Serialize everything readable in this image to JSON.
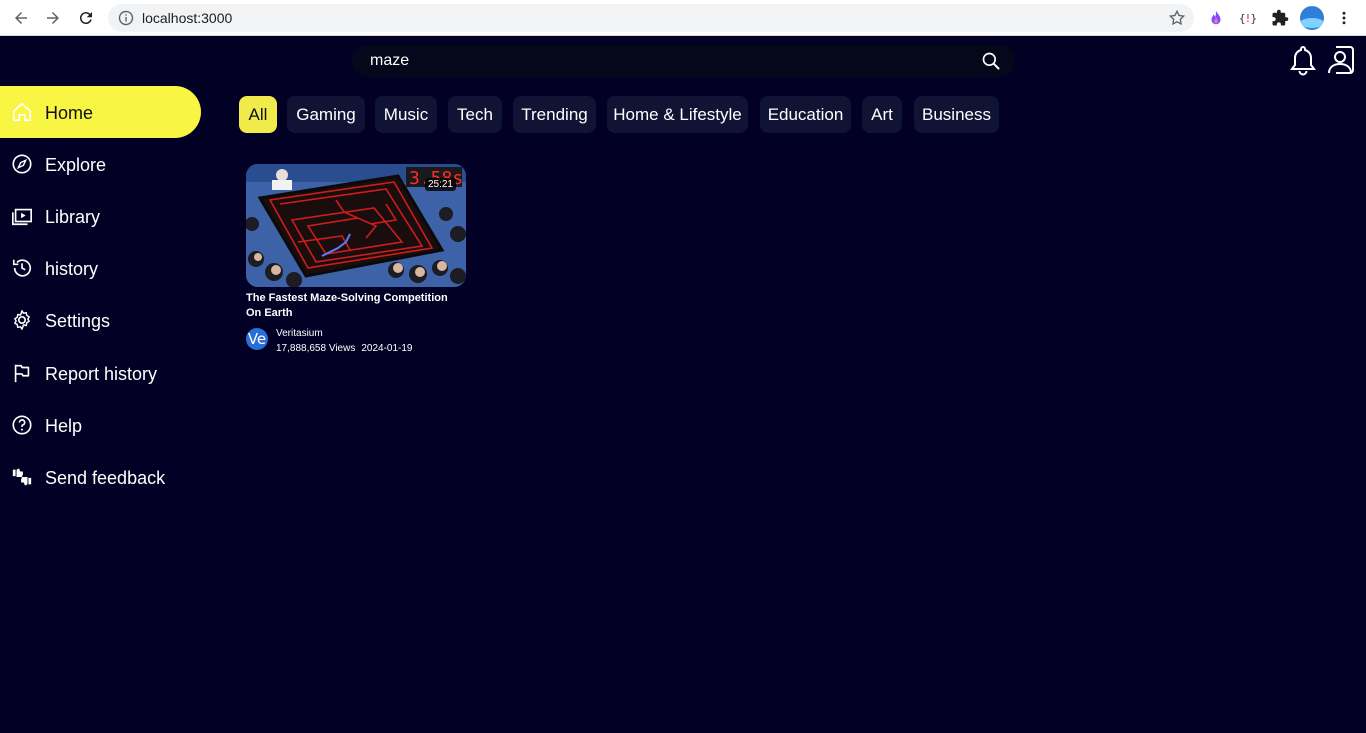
{
  "browser": {
    "url": "localhost:3000"
  },
  "search": {
    "value": "maze"
  },
  "sidebar": {
    "items": [
      {
        "label": "Home",
        "icon": "home-icon"
      },
      {
        "label": "Explore",
        "icon": "compass-icon"
      },
      {
        "label": "Library",
        "icon": "library-icon"
      },
      {
        "label": "history",
        "icon": "history-icon"
      },
      {
        "label": "Settings",
        "icon": "gear-icon"
      },
      {
        "label": "Report history",
        "icon": "flag-icon"
      },
      {
        "label": "Help",
        "icon": "help-icon"
      },
      {
        "label": "Send feedback",
        "icon": "feedback-icon"
      }
    ]
  },
  "chips": [
    "All",
    "Gaming",
    "Music",
    "Tech",
    "Trending",
    "Home & Lifestyle",
    "Education",
    "Art",
    "Business"
  ],
  "video": {
    "title": "The Fastest Maze-Solving Competition On Earth",
    "duration": "25:21",
    "channel": "Veritasium",
    "avatar_text": "Ve",
    "views": "17,888,658 Views",
    "date": "2024-01-19"
  },
  "colors": {
    "background": "#020024",
    "accent": "#f8f543",
    "chip": "#111335"
  }
}
